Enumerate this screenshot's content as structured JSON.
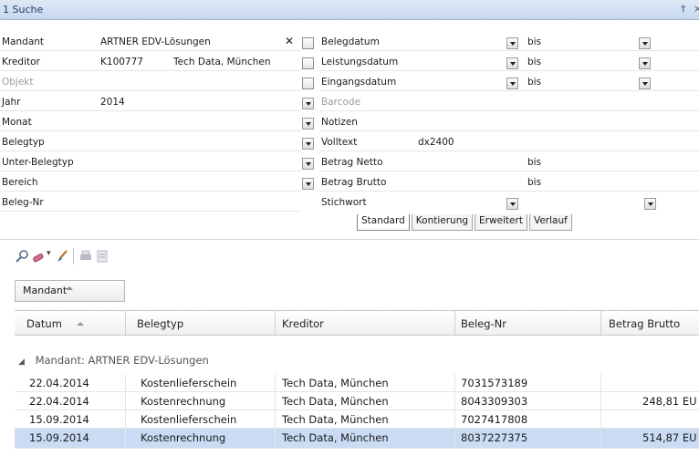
{
  "panel": {
    "title": "1 Suche",
    "pin_glyph": "†",
    "close_glyph": "×"
  },
  "left_fields": [
    {
      "label": "Mandant",
      "value": "ARTNER EDV-Lösungen",
      "enabled": true
    },
    {
      "label": "Kreditor",
      "value": "K100777",
      "value2": "Tech Data, München",
      "enabled": true
    },
    {
      "label": "Objekt",
      "value": "",
      "enabled": false
    },
    {
      "label": "Jahr",
      "value": "2014",
      "enabled": true
    },
    {
      "label": "Monat",
      "value": "",
      "enabled": true
    },
    {
      "label": "Belegtyp",
      "value": "",
      "enabled": true
    },
    {
      "label": "Unter-Belegtyp",
      "value": "",
      "enabled": true
    },
    {
      "label": "Bereich",
      "value": "",
      "enabled": true
    },
    {
      "label": "Beleg-Nr",
      "value": "",
      "enabled": true
    }
  ],
  "right_fields": [
    {
      "label": "Belegdatum",
      "range_label": "bis",
      "enabled": true
    },
    {
      "label": "Leistungsdatum",
      "range_label": "bis",
      "enabled": true
    },
    {
      "label": "Eingangsdatum",
      "range_label": "bis",
      "enabled": true
    },
    {
      "label": "Barcode",
      "enabled": false
    },
    {
      "label": "Notizen",
      "enabled": true
    },
    {
      "label": "Volltext",
      "value": "dx2400",
      "enabled": true
    },
    {
      "label": "Betrag Netto",
      "range_label": "bis",
      "enabled": true
    },
    {
      "label": "Betrag Brutto",
      "range_label": "bis",
      "enabled": true
    },
    {
      "label": "Stichwort",
      "enabled": true
    }
  ],
  "tabs": [
    "Standard",
    "Kontierung",
    "Erweitert",
    "Verlauf"
  ],
  "active_tab": "Standard",
  "toolbar_icons": [
    "search-icon",
    "eraser-icon",
    "brush-icon",
    "print-icon",
    "export-icon"
  ],
  "group_box_label": "Mandant",
  "grid": {
    "columns": [
      "Datum",
      "Belegtyp",
      "Kreditor",
      "Beleg-Nr",
      "Betrag Brutto"
    ],
    "group_caption": "Mandant: ARTNER EDV-Lösungen",
    "group_toggle": "◢",
    "rows": [
      [
        "22.04.2014",
        "Kostenlieferschein",
        "Tech Data, München",
        "7031573189",
        ""
      ],
      [
        "22.04.2014",
        "Kostenrechnung",
        "Tech Data, München",
        "8043309303",
        "248,81 EU"
      ],
      [
        "15.09.2014",
        "Kostenlieferschein",
        "Tech Data, München",
        "7027417808",
        ""
      ],
      [
        "15.09.2014",
        "Kostenrechnung",
        "Tech Data, München",
        "8037227375",
        "514,87 EU"
      ]
    ],
    "selected_row": 3
  },
  "colors": {
    "selection": "#c9dcf3",
    "titlebar": "#c7d8ee"
  }
}
